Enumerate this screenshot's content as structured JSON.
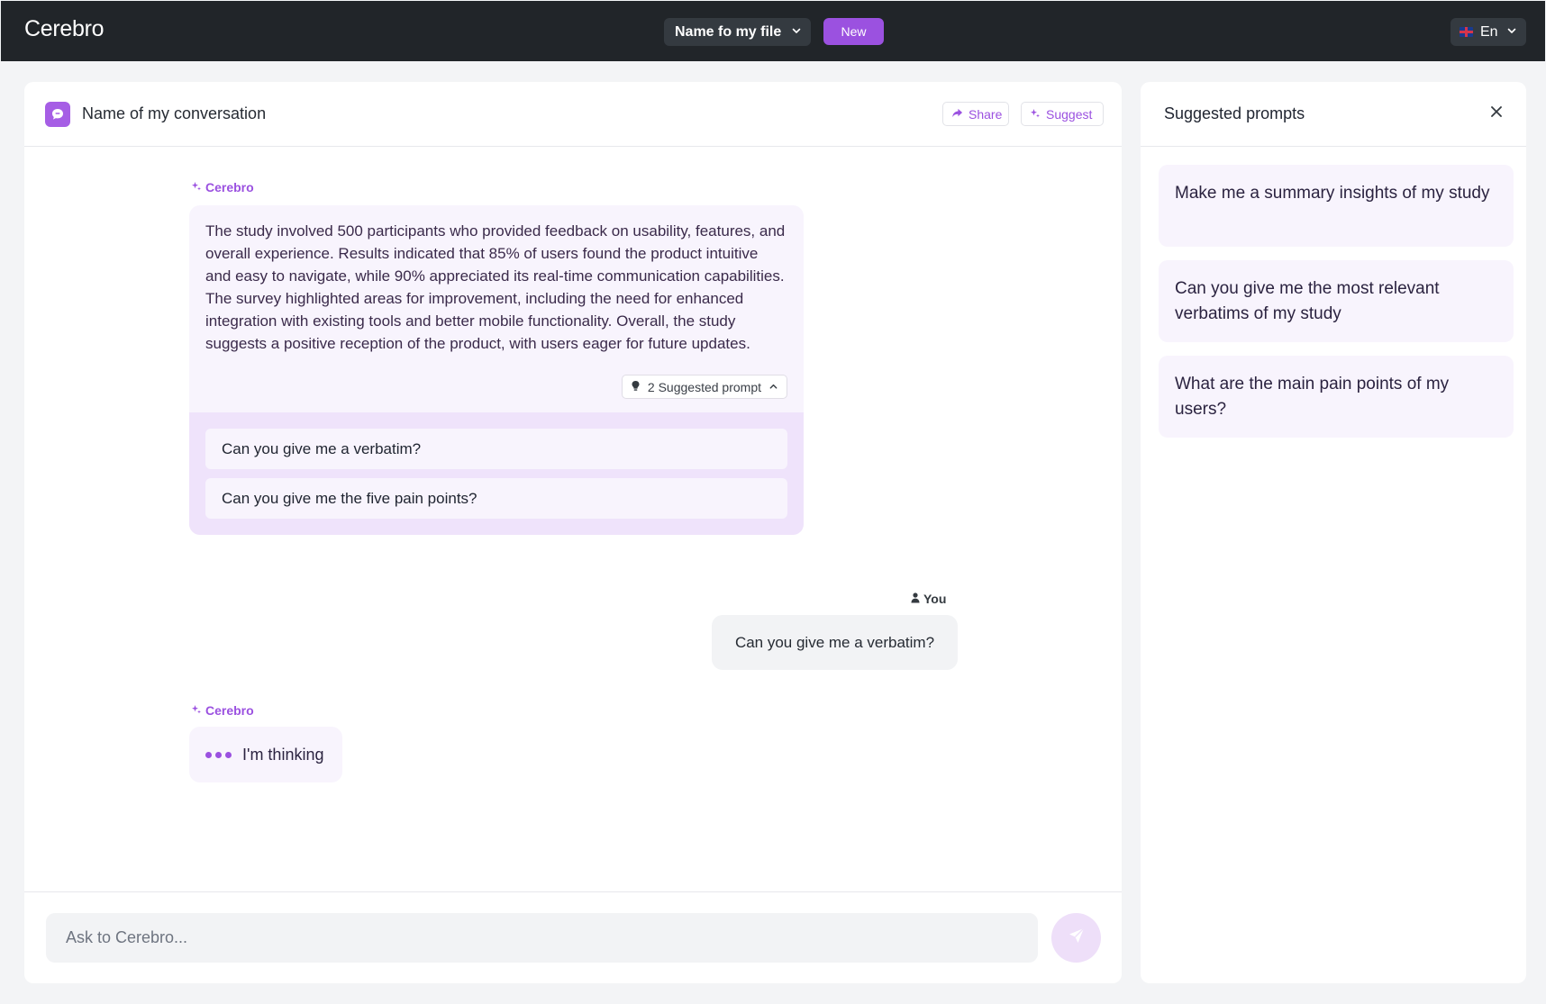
{
  "app": {
    "name": "Cerebro"
  },
  "topbar": {
    "file_name": "Name fo my file",
    "new_label": "New",
    "language": "En"
  },
  "conversation": {
    "title": "Name of my conversation",
    "share_label": "Share",
    "suggest_label": "Suggest"
  },
  "messages": {
    "ai_sender": "Cerebro",
    "ai_response": "The study involved 500 participants who provided feedback on usability, features, and overall experience. Results indicated that 85% of users found the product intuitive and easy to navigate, while 90% appreciated its real-time communication capabilities. The survey highlighted areas for improvement, including the need for enhanced integration with existing tools and better mobile functionality. Overall, the study suggests a positive reception of the product, with users eager for future updates.",
    "suggested_toggle": "2 Suggested prompt",
    "suggested": [
      "Can you give me a verbatim?",
      "Can you give me the five pain points?"
    ],
    "user_sender": "You",
    "user_message": "Can you give me a verbatim?",
    "ai_sender_2": "Cerebro",
    "thinking_text": "I'm thinking"
  },
  "input": {
    "placeholder": "Ask to Cerebro..."
  },
  "suggested_panel": {
    "title": "Suggested prompts",
    "prompts": [
      "Make me a summary insights of my study",
      "Can you give me the most relevant verbatims of my study",
      "What are the main pain points of my users?"
    ]
  },
  "colors": {
    "accent": "#9b51e0",
    "topbar": "#212529",
    "ai_bubble": "#f8f4fd",
    "suggestion_bg": "#efe3fb"
  },
  "icons": [
    "chevron-down-icon",
    "flag-uk-icon",
    "chat-icon",
    "share-icon",
    "sparkle-icon",
    "lightbulb-icon",
    "chevron-up-icon",
    "user-icon",
    "send-icon",
    "close-icon"
  ]
}
